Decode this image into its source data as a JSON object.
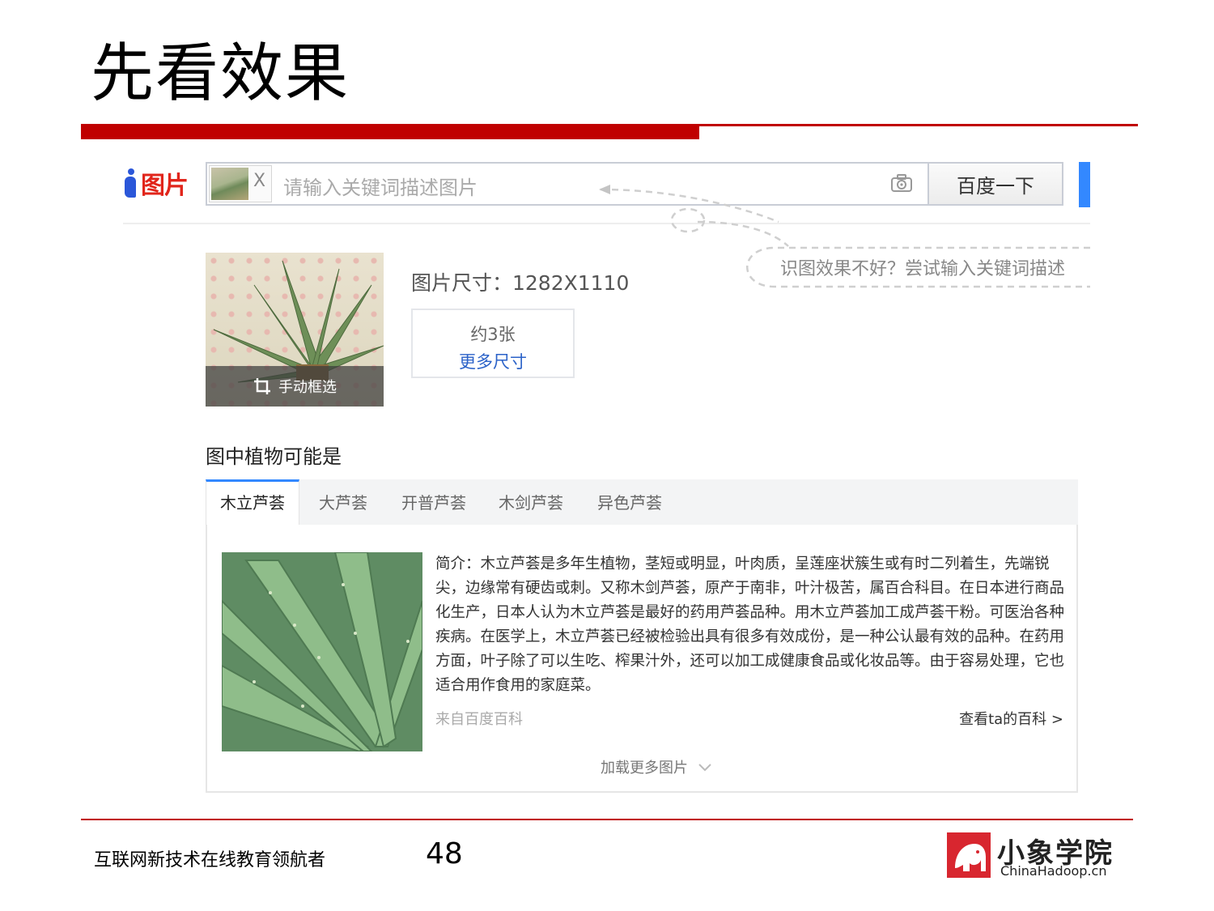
{
  "slide": {
    "title": "先看效果",
    "footer_text": "互联网新技术在线教育领航者",
    "page_number": "48",
    "brand_name": "小象学院",
    "brand_url": "ChinaHadoop.cn"
  },
  "colors": {
    "accent_red": "#c00000",
    "link_blue": "#2b62c8",
    "baidu_blue": "#3388ff"
  },
  "header": {
    "logo_text": "图片",
    "search_placeholder": "请输入关键词描述图片",
    "chip_remove": "X",
    "search_button": "百度一下",
    "camera_icon": "camera-icon"
  },
  "hint": {
    "text": "识图效果不好？尝试输入关键词描述"
  },
  "preview": {
    "crop_label": "手动框选"
  },
  "size_info": {
    "label": "图片尺寸：1282X1110",
    "count": "约3张",
    "more": "更多尺寸"
  },
  "plants": {
    "section_title": "图中植物可能是",
    "tabs": [
      {
        "label": "木立芦荟",
        "active": true
      },
      {
        "label": "大芦荟",
        "active": false
      },
      {
        "label": "开普芦荟",
        "active": false
      },
      {
        "label": "木剑芦荟",
        "active": false
      },
      {
        "label": "异色芦荟",
        "active": false
      }
    ],
    "intro": "简介：木立芦荟是多年生植物，茎短或明显，叶肉质，呈莲座状簇生或有时二列着生，先端锐尖，边缘常有硬齿或刺。又称木剑芦荟，原产于南非，叶汁极苦，属百合科目。在日本进行商品化生产，日本人认为木立芦荟是最好的药用芦荟品种。用木立芦荟加工成芦荟干粉。可医治各种疾病。在医学上，木立芦荟已经被检验出具有很多有效成份，是一种公认最有效的品种。在药用方面，叶子除了可以生吃、榨果汁外，还可以加工成健康食品或化妆品等。由于容易处理，它也适合用作食用的家庭菜。",
    "source": "来自百度百科",
    "baike_link": "查看ta的百科 >",
    "load_more": "加载更多图片"
  }
}
